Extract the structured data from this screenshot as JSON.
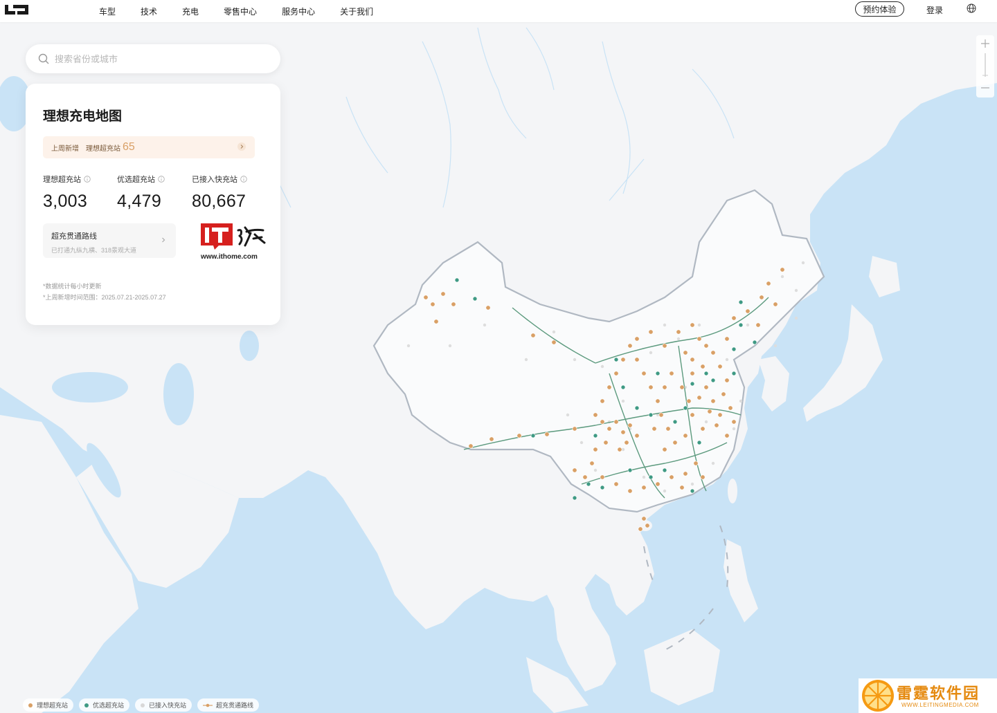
{
  "header": {
    "nav": [
      "车型",
      "技术",
      "充电",
      "零售中心",
      "服务中心",
      "关于我们"
    ],
    "reserve_label": "预约体验",
    "login_label": "登录"
  },
  "search": {
    "placeholder": "搜索省份或城市"
  },
  "panel": {
    "title": "理想充电地图",
    "weekly_new": {
      "prefix": "上周新增",
      "item": "理想超充站",
      "count": "65"
    },
    "stats": [
      {
        "label": "理想超充站",
        "value": "3,003"
      },
      {
        "label": "优选超充站",
        "value": "4,479"
      },
      {
        "label": "已接入快充站",
        "value": "80,667"
      }
    ],
    "route": {
      "title": "超充贯通路线",
      "subtitle": "已打通九纵九横、318景观大道"
    },
    "notes": [
      "*数据统计每小时更新",
      "*上周新增时间范围：2025.07.21-2025.07.27"
    ]
  },
  "watermark_ithome": "www.ithome.com",
  "legend": [
    {
      "label": "理想超充站",
      "color": "#d9a066"
    },
    {
      "label": "优选超充站",
      "color": "#3f9a84"
    },
    {
      "label": "已接入快充站",
      "color": "#d8d8d8"
    },
    {
      "label": "超充贯通路线",
      "color": "#d9a066"
    }
  ],
  "watermark_site": {
    "name": "雷霆软件园",
    "url": "WWW.LEITINGMEDIA.COM"
  },
  "colors": {
    "li_station": "#d9a066",
    "preferred_station": "#3f9a84",
    "fast_station": "#d8d8d8",
    "sea": "#c9e3f6",
    "land": "#f4f5f7"
  }
}
